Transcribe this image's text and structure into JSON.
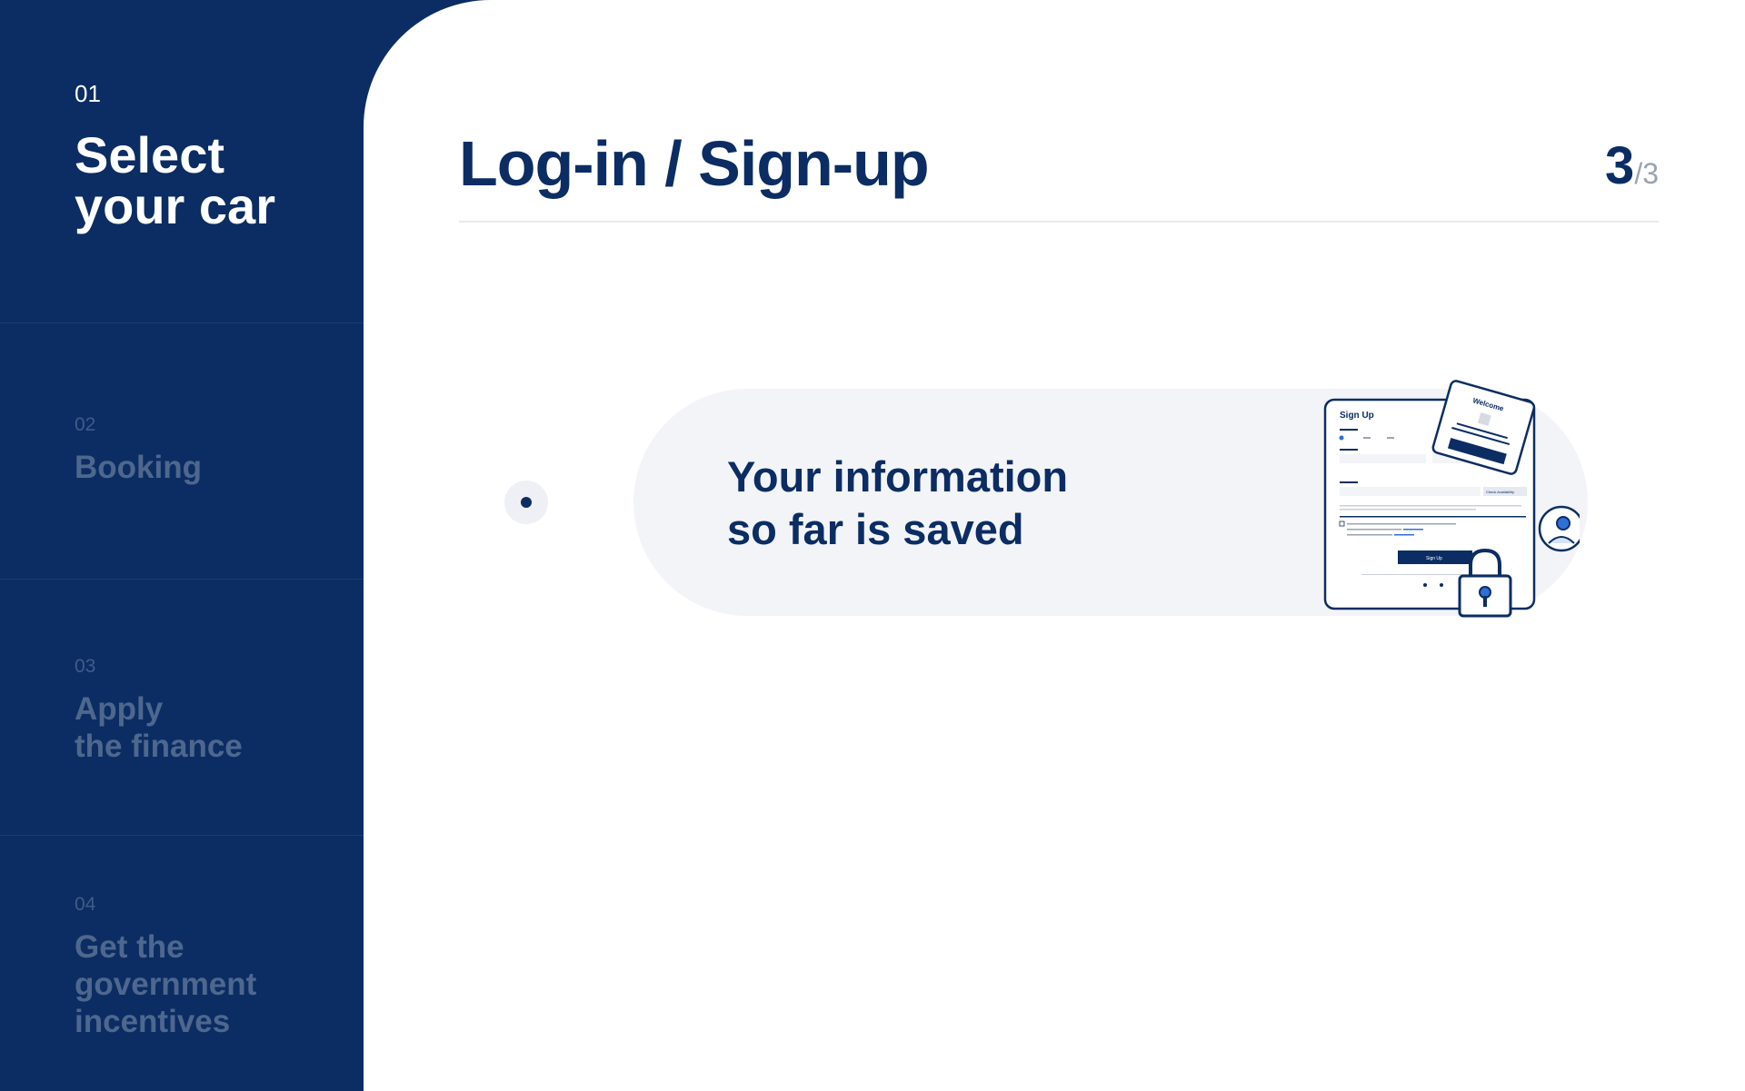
{
  "sidebar": {
    "steps": [
      {
        "number": "01",
        "title": "Select\nyour car",
        "active": true
      },
      {
        "number": "02",
        "title": "Booking",
        "active": false
      },
      {
        "number": "03",
        "title": "Apply\nthe finance",
        "active": false
      },
      {
        "number": "04",
        "title": "Get the\ngovernment\nincentives",
        "active": false
      }
    ]
  },
  "header": {
    "title": "Log-in / Sign-up",
    "page_current": "3",
    "page_total": "/3"
  },
  "info": {
    "message": "Your information\nso far is saved"
  },
  "illustration": {
    "signup_title": "Sign Up",
    "welcome_label": "Welcome",
    "signup_button": "Sign Up",
    "check_button": "Check Availability"
  },
  "colors": {
    "brand_navy": "#0b2d63",
    "pill_bg": "#f3f4f8",
    "accent_blue": "#2f6fd6"
  }
}
